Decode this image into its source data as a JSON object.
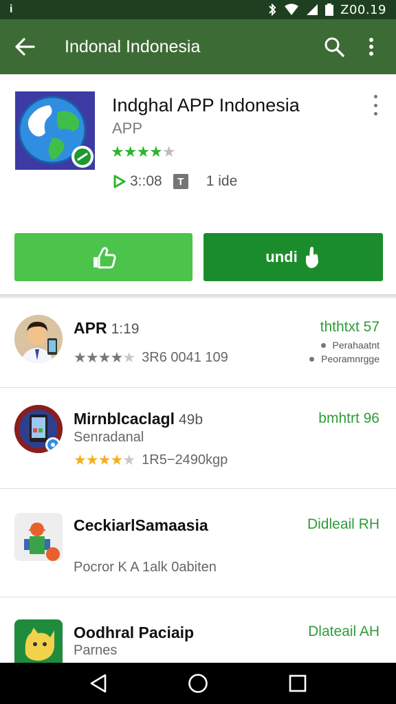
{
  "status_bar": {
    "left_icon": "i",
    "clock": "Z00.19",
    "icons": [
      "bluetooth-icon",
      "wifi-icon",
      "signal-icon",
      "battery-icon"
    ]
  },
  "toolbar": {
    "title": "Indonal Indonesia",
    "icons": [
      "back-arrow-icon",
      "search-icon",
      "more-vert-icon"
    ]
  },
  "app": {
    "name": "Indghal APP Indonesia",
    "subtitle": "APP",
    "rating_stars": 4.5,
    "time": "3::08",
    "badge": "T",
    "meta": "1 ide",
    "install_label": "",
    "open_label": "undi"
  },
  "list": [
    {
      "title": "APR",
      "version": "1:19",
      "rating_stars": 4,
      "rating_text": "3R6 0041 109",
      "right_label": "ththtxt 57",
      "notes": [
        "Perahaatnt",
        "Peoramnrgge"
      ]
    },
    {
      "title": "Mirnblcaclagl",
      "version": "49b",
      "subtitle": "Senradanal",
      "rating_stars": 4,
      "rating_text": "1R5−2490kgp",
      "right_label": "bmhtrt 96"
    },
    {
      "title": "CeckiarlSamaasia",
      "subtitle": "Pocror K A 1alk 0abiten",
      "right_label": "Didleail RH"
    },
    {
      "title": "Oodhral Paciaip",
      "subtitle": "Parnes",
      "right_label": "Dlateail AH"
    }
  ],
  "colors": {
    "toolbar": "#3d6b35",
    "status_bar": "#1e3f20",
    "install_button": "#4cc34a",
    "open_button": "#1b8c2b",
    "accent_green": "#2e9b3a"
  }
}
